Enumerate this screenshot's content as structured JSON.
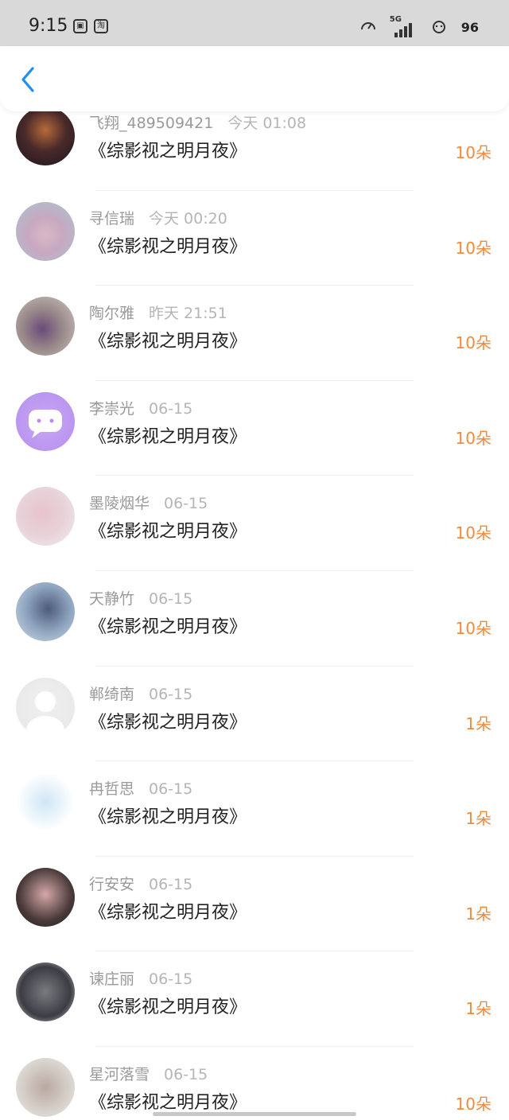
{
  "status_bar": {
    "time": "9:15",
    "app_icons": [
      "box",
      "淘"
    ],
    "network": "5G",
    "battery": "96"
  },
  "list": {
    "items": [
      {
        "name": "飞翔_489509421",
        "time": "今天 01:08",
        "title": "《综影视之明月夜》",
        "count": "10朵",
        "avatar_style": "dark-fantasy"
      },
      {
        "name": "寻信瑞",
        "time": "今天 00:20",
        "title": "《综影视之明月夜》",
        "count": "10朵",
        "avatar_style": "pink-tree"
      },
      {
        "name": "陶尔雅",
        "time": "昨天 21:51",
        "title": "《综影视之明月夜》",
        "count": "10朵",
        "avatar_style": "girls-photo"
      },
      {
        "name": "李崇光",
        "time": "06-15",
        "title": "《综影视之明月夜》",
        "count": "10朵",
        "avatar_style": "purple-chat"
      },
      {
        "name": "墨陵烟华",
        "time": "06-15",
        "title": "《综影视之明月夜》",
        "count": "10朵",
        "avatar_style": "pink-rose"
      },
      {
        "name": "天静竹",
        "time": "06-15",
        "title": "《综影视之明月夜》",
        "count": "10朵",
        "avatar_style": "anime-girl"
      },
      {
        "name": "郸绮南",
        "time": "06-15",
        "title": "《综影视之明月夜》",
        "count": "1朵",
        "avatar_style": "default-gray"
      },
      {
        "name": "冉哲思",
        "time": "06-15",
        "title": "《综影视之明月夜》",
        "count": "1朵",
        "avatar_style": "jar"
      },
      {
        "name": "行安安",
        "time": "06-15",
        "title": "《综影视之明月夜》",
        "count": "1朵",
        "avatar_style": "woman-portrait"
      },
      {
        "name": "谏庄丽",
        "time": "06-15",
        "title": "《综影视之明月夜》",
        "count": "1朵",
        "avatar_style": "couple"
      },
      {
        "name": "星河落雪",
        "time": "06-15",
        "title": "《综影视之明月夜》",
        "count": "10朵",
        "avatar_style": "woman-blossom"
      }
    ]
  },
  "colors": {
    "accent": "#f08a3c",
    "back": "#1e8ff0",
    "status_bar": "#d9d9d9"
  }
}
